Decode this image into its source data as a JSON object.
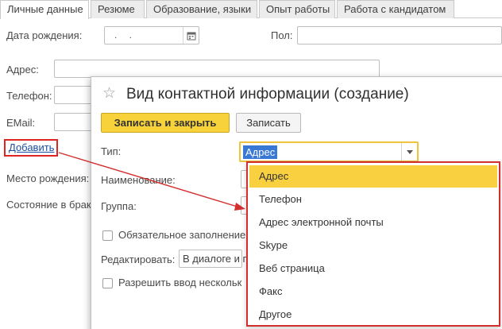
{
  "tabs": [
    {
      "label": "Личные данные",
      "active": true
    },
    {
      "label": "Резюме",
      "active": false
    },
    {
      "label": "Образование, языки",
      "active": false
    },
    {
      "label": "Опыт работы",
      "active": false
    },
    {
      "label": "Работа с кандидатом",
      "active": false
    }
  ],
  "form": {
    "birth_date_label": "Дата рождения:",
    "birth_date_value": ". .",
    "gender_label": "Пол:",
    "address_label": "Адрес:",
    "phone_label": "Телефон:",
    "email_label": "EMail:",
    "add_link": "Добавить",
    "birthplace_label": "Место рождения:",
    "marital_label": "Состояние в брак"
  },
  "dialog": {
    "title": "Вид контактной информации (создание)",
    "save_close_label": "Записать и закрыть",
    "save_label": "Записать",
    "type_label": "Тип:",
    "type_value": "Адрес",
    "name_label": "Наименование:",
    "group_label": "Группа:",
    "required_label": "Обязательное заполнение",
    "edit_label": "Редактировать:",
    "edit_value": "В диалоге и п",
    "multi_label": "Разрешить ввод нескольк"
  },
  "dropdown": {
    "items": [
      {
        "label": "Адрес",
        "selected": true
      },
      {
        "label": "Телефон",
        "selected": false
      },
      {
        "label": "Адрес электронной почты",
        "selected": false
      },
      {
        "label": "Skype",
        "selected": false
      },
      {
        "label": "Веб страница",
        "selected": false
      },
      {
        "label": "Факс",
        "selected": false
      },
      {
        "label": "Другое",
        "selected": false
      }
    ]
  },
  "colors": {
    "accent": "#f9d03f",
    "annotation": "#d32f2f",
    "link": "#1a4fa0",
    "selection": "#3a78d6"
  }
}
